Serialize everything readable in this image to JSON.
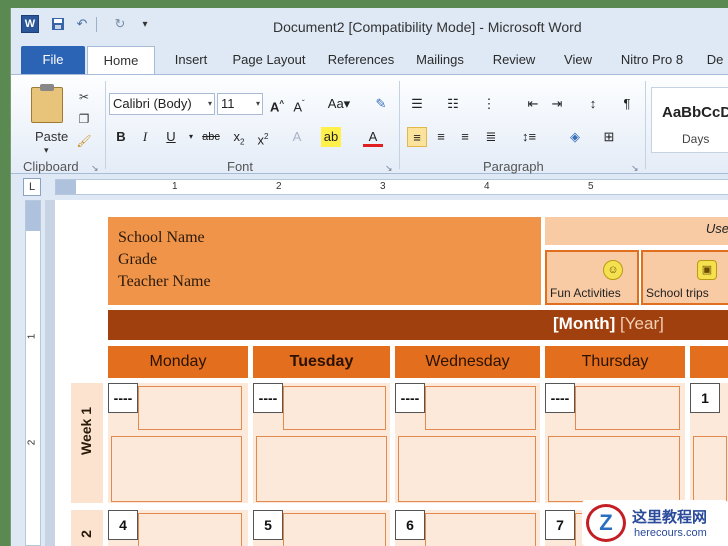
{
  "window": {
    "title": "Document2 [Compatibility Mode] - Microsoft Word"
  },
  "tabs": [
    "File",
    "Home",
    "Insert",
    "Page Layout",
    "References",
    "Mailings",
    "Review",
    "View",
    "Nitro Pro 8",
    "De"
  ],
  "clipboard": {
    "paste_label": "Paste",
    "group_label": "Clipboard"
  },
  "font": {
    "family": "Calibri (Body)",
    "size": "11",
    "group_label": "Font"
  },
  "paragraph": {
    "group_label": "Paragraph"
  },
  "styles": {
    "sample": "AaBbCcD",
    "name": "Days"
  },
  "ruler": {
    "h_numbers": [
      "1",
      "2",
      "3",
      "4",
      "5"
    ],
    "v_numbers": [
      "1",
      "2"
    ]
  },
  "document": {
    "header_lines": [
      "School Name",
      "Grade",
      "Teacher Name"
    ],
    "legend_title": "Use",
    "legend_items": [
      "Fun Activities",
      "School trips"
    ],
    "month": "[Month]",
    "year": "[Year]",
    "days": [
      "Monday",
      "Tuesday",
      "Wednesday",
      "Thursday"
    ],
    "week_labels": [
      "Week 1",
      "2"
    ],
    "week1_dates": [
      "----",
      "----",
      "----",
      "----",
      "1"
    ],
    "week2_dates": [
      "4",
      "5",
      "6",
      "7"
    ]
  },
  "watermark": {
    "text": "这里教程网",
    "url": "herecours.com"
  }
}
